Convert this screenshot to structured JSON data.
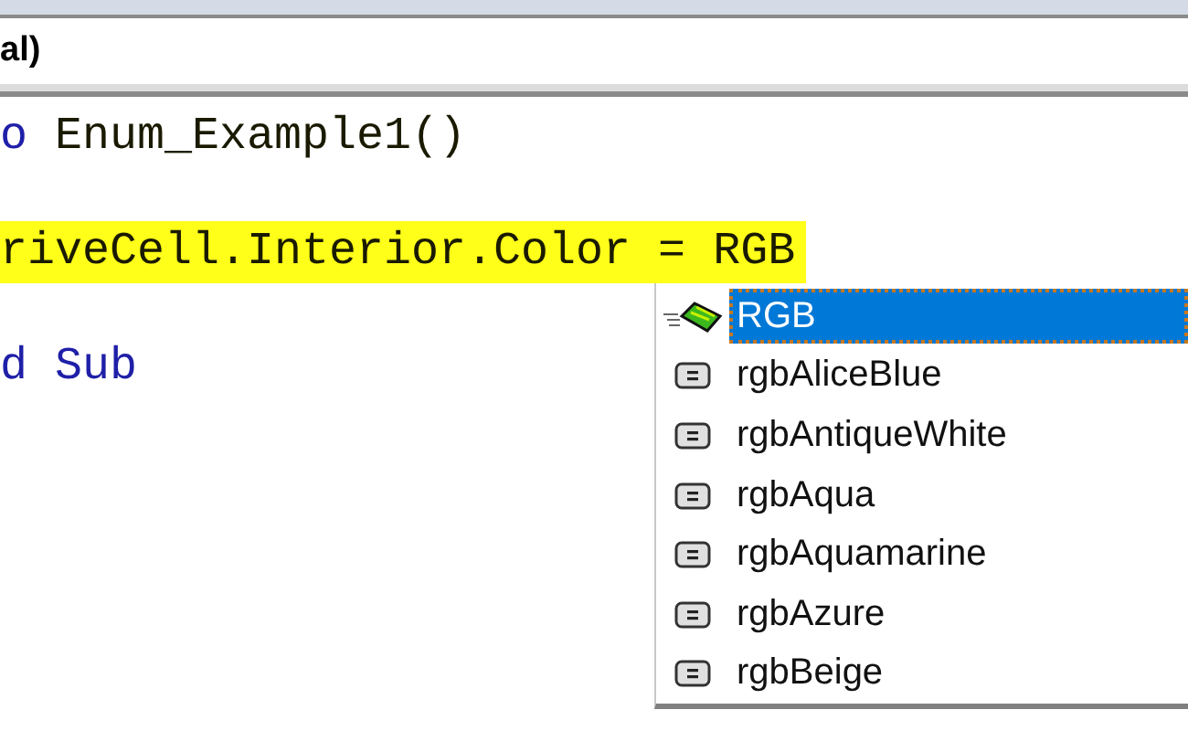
{
  "header": {
    "title": "al)"
  },
  "code_lines": [
    {
      "segments": [
        {
          "kind": "keyword",
          "text": "o"
        },
        {
          "kind": "plain",
          "text": " Enum_Example1()"
        }
      ],
      "highlighted": false
    },
    {
      "highlighted": false
    },
    {
      "segments": [
        {
          "kind": "plain",
          "text": "riveCell.Interior.Color = RGB"
        }
      ],
      "highlighted": true
    },
    {
      "highlighted": false
    },
    {
      "segments": [
        {
          "kind": "keyword",
          "text": "d Sub"
        }
      ],
      "highlighted": false
    }
  ],
  "completion_list": [
    {
      "label": "RGB",
      "kind": "method",
      "selected": true
    },
    {
      "label": "rgbAliceBlue",
      "kind": "constant",
      "selected": false
    },
    {
      "label": "rgbAntiqueWhite",
      "kind": "constant",
      "selected": false
    },
    {
      "label": "rgbAqua",
      "kind": "constant",
      "selected": false
    },
    {
      "label": "rgbAquamarine",
      "kind": "constant",
      "selected": false
    },
    {
      "label": "rgbAzure",
      "kind": "constant",
      "selected": false
    },
    {
      "label": "rgbBeige",
      "kind": "constant",
      "selected": false
    }
  ]
}
